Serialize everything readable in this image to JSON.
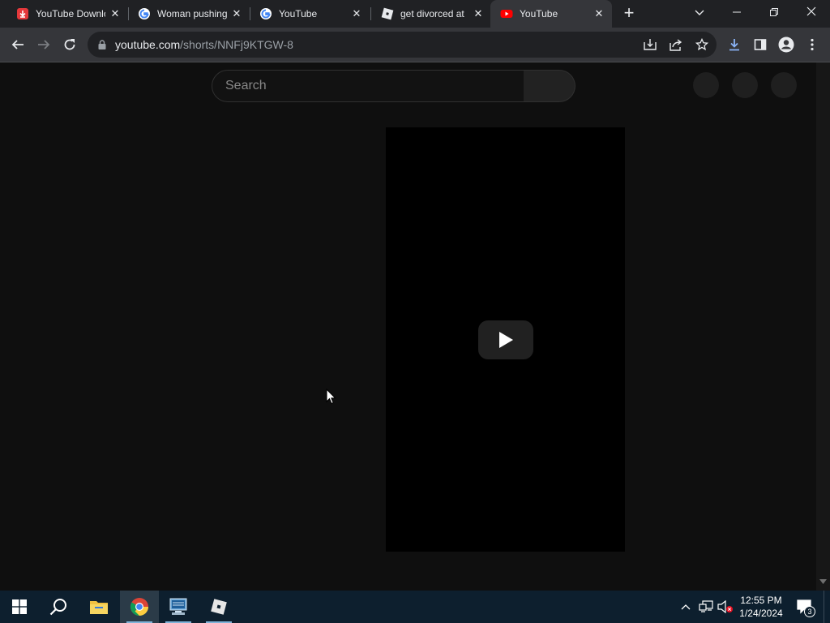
{
  "browser": {
    "tabs": [
      {
        "title": "YouTube Downlo",
        "favicon": "download-icon",
        "active": false
      },
      {
        "title": "Woman pushing",
        "favicon": "google-icon",
        "active": false
      },
      {
        "title": "YouTube",
        "favicon": "google-icon",
        "active": false
      },
      {
        "title": "get divorced at",
        "favicon": "roblox-icon",
        "active": false
      },
      {
        "title": "YouTube",
        "favicon": "youtube-icon",
        "active": true
      }
    ],
    "tab_close_glyph": "✕",
    "new_tab_glyph": "+",
    "address": {
      "domain": "youtube.com",
      "path": "/shorts/NNFj9KTGW-8"
    }
  },
  "youtube": {
    "search": {
      "placeholder": "Search"
    }
  },
  "taskbar": {
    "clock": {
      "time": "12:55 PM",
      "date": "1/24/2024"
    },
    "notification_count": "3"
  },
  "colors": {
    "brand_red": "#ff0000",
    "page_bg": "#0f0f0f",
    "taskbar_bg": "#0d1f2e"
  }
}
